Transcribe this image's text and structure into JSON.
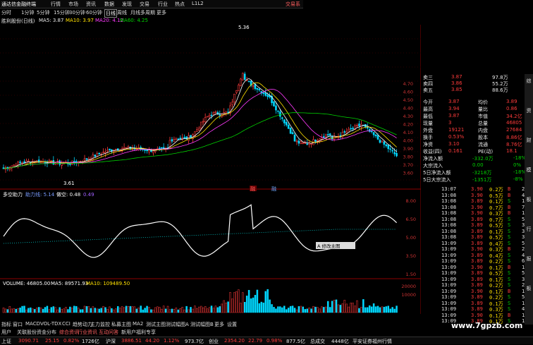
{
  "menu": {
    "app_name": "通达信金融终端",
    "items": [
      "行情",
      "市场",
      "资讯",
      "数据",
      "发现",
      "交易",
      "行业",
      "热点",
      "L1L2"
    ],
    "right": "交易系"
  },
  "timeframes": [
    "分时",
    "1分钟",
    "5分钟",
    "15分钟",
    "30分钟",
    "60分钟",
    "日线",
    "周线",
    "月线",
    "多周期",
    "更多"
  ],
  "timeframe_selected": 6,
  "ma_header": {
    "stock": "胜利股份(日线)",
    "ma5": "MA5: 3.87",
    "ma10": "MA10: 3.97",
    "ma20": "MA20: 4.12",
    "ma60": "MA60: 4.25"
  },
  "chart": {
    "peak_label": "5.36",
    "low_label": "3.61",
    "tag1": "融",
    "tag2": "融",
    "dates": [
      "2022年",
      "2022/09/08/四",
      "10",
      "11",
      "12"
    ]
  },
  "indicator1": {
    "name": "多空助力",
    "l1": "助力线: 5.14",
    "l2": "做空: 0.48",
    "l3": "0.49",
    "value_box": "9.54"
  },
  "indicator2": {
    "name": "VOLUME: 46805.00",
    "ma5": "MA5: 89571.93",
    "ma10": "MA10: 109489.50"
  },
  "popup": "A 修改主图",
  "y_axis_price": [
    "4.70",
    "4.60",
    "4.50",
    "4.40",
    "4.30",
    "4.20",
    "4.10",
    "4.00",
    "3.90",
    "3.80",
    "3.70",
    "3.60"
  ],
  "y_axis_ind": [
    "8.00",
    "6.50",
    "5.00",
    "3.50",
    "1.50"
  ],
  "y_axis_vol": [
    "20000",
    "10000"
  ],
  "quotes_asks": [
    {
      "label": "卖五",
      "price": "3.85",
      "vol": "88.6万"
    },
    {
      "label": "卖四",
      "price": "3.86",
      "vol": "55.2万"
    },
    {
      "label": "卖三",
      "price": "3.87",
      "vol": "97.8万"
    }
  ],
  "quotes_stats": [
    [
      "今开",
      "3.87",
      "均价",
      "3.89"
    ],
    [
      "最高",
      "3.94",
      "量比",
      "0.86"
    ],
    [
      "最低",
      "3.87",
      "市值",
      "34.2亿"
    ],
    [
      "现量",
      "3",
      "总量",
      "46805"
    ],
    [
      "外盘",
      "19121",
      "内盘",
      "27684"
    ],
    [
      "换手",
      "0.53%",
      "股本",
      "8.86亿"
    ],
    [
      "净资",
      "3.10",
      "流通",
      "8.76亿"
    ],
    [
      "收益(四)",
      "0.161",
      "PE(动)",
      "18.1"
    ]
  ],
  "flows": [
    {
      "label": "净流入额",
      "val": "-332.0万",
      "pct": "-18%"
    },
    {
      "label": "大宗流入",
      "val": "0.00",
      "pct": "0%"
    },
    {
      "label": "5日净流入额",
      "val": "-3218万",
      "pct": "-18%"
    },
    {
      "label": "5日大宗流入",
      "val": "-1351万",
      "pct": "-8%"
    }
  ],
  "ticks": [
    [
      "13:07",
      "3.90",
      "0.2万",
      "B",
      "2"
    ],
    [
      "13:08",
      "3.90",
      "0.5万",
      "B",
      "4"
    ],
    [
      "13:08",
      "3.89",
      "0.1万",
      "S",
      "1"
    ],
    [
      "13:08",
      "3.90",
      "0.7万",
      "B",
      "7"
    ],
    [
      "13:08",
      "3.90",
      "0.3万",
      "B",
      "1"
    ],
    [
      "13:08",
      "3.89",
      "0.7万",
      "S",
      "5"
    ],
    [
      "13:08",
      "3.89",
      "0.5万",
      "S",
      "3"
    ],
    [
      "13:08",
      "3.89",
      "0.1万",
      "S",
      "3"
    ],
    [
      "13:08",
      "3.89",
      "0.5万",
      "S",
      "3"
    ],
    [
      "13:09",
      "3.89",
      "0.4万",
      "S",
      "5"
    ],
    [
      "13:09",
      "3.90",
      "0.3万",
      "B",
      "2"
    ],
    [
      "13:09",
      "3.89",
      "0.4万",
      "S",
      "4"
    ],
    [
      "13:09",
      "3.89",
      "0.2万",
      "S",
      "6"
    ],
    [
      "13:09",
      "3.90",
      "0.1万",
      "B",
      "1"
    ],
    [
      "13:09",
      "3.89",
      "0.5万",
      "S",
      "5"
    ],
    [
      "13:09",
      "3.89",
      "0.1万",
      "S",
      "3"
    ],
    [
      "13:09",
      "3.89",
      "0.2万",
      "S",
      "2"
    ],
    [
      "13:09",
      "3.90",
      "0.1万",
      "B",
      "1"
    ],
    [
      "13:09",
      "3.89",
      "0.2万",
      "S",
      "5"
    ],
    [
      "13:09",
      "3.89",
      "0.1万",
      "S",
      "1"
    ],
    [
      "13:09",
      "3.89",
      "0.3万",
      "S",
      "4"
    ],
    [
      "13:09",
      "3.90",
      "0.1万",
      "B",
      "1"
    ],
    [
      "13:09",
      "3.89",
      "0.1万",
      "S",
      "1"
    ]
  ],
  "bottom_tabs": [
    "指标",
    "窗口",
    "MACD",
    "VOL-TDX",
    "CCI",
    "趋势动力",
    "主力监控",
    "私募主图",
    "MA2",
    "测试主图",
    "测试幅图A",
    "测试幅图B",
    "更多",
    "设置"
  ],
  "bottom_tabs2": [
    "用户",
    "关联股份",
    "资金分布",
    "综合资讯",
    "行业资讯",
    "互动问答",
    "新用户福利专享"
  ],
  "status": [
    {
      "t": "上证",
      "c": "white"
    },
    {
      "t": "3090.71",
      "c": "red"
    },
    {
      "t": "25.15",
      "c": "red"
    },
    {
      "t": "0.82%",
      "c": "red"
    },
    {
      "t": "1726亿",
      "c": "white"
    },
    {
      "t": "沪深",
      "c": "white"
    },
    {
      "t": "3886.51",
      "c": "red"
    },
    {
      "t": "44.20",
      "c": "red"
    },
    {
      "t": "1.12%",
      "c": "red"
    },
    {
      "t": "973.7亿",
      "c": "white"
    },
    {
      "t": "创业",
      "c": "white"
    },
    {
      "t": "2354.20",
      "c": "red"
    },
    {
      "t": "22.79",
      "c": "red"
    },
    {
      "t": "0.98%",
      "c": "red"
    },
    {
      "t": "877.5亿",
      "c": "white"
    },
    {
      "t": "总成交",
      "c": "white"
    },
    {
      "t": "4448亿",
      "c": "white"
    },
    {
      "t": "平安证券福州行情",
      "c": "white"
    }
  ],
  "sidebar": [
    "综",
    "资",
    "财",
    "模",
    "板",
    "行",
    "报",
    "板"
  ],
  "watermark": "www.7gpzb.com",
  "colors": {
    "up": "#ff3b3b",
    "down": "#00d8ff",
    "ma5": "#ffffff",
    "ma10": "#ffe000",
    "ma20": "#ff3bff",
    "ma60": "#00d200",
    "dif": "#7a4cff"
  }
}
